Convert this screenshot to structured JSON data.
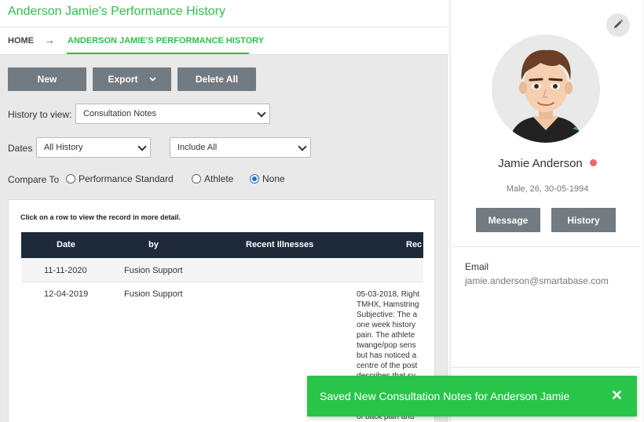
{
  "page": {
    "title": "Anderson Jamie's Performance History"
  },
  "breadcrumb": {
    "home": "HOME",
    "arrow": "→",
    "current": "ANDERSON JAMIE'S PERFORMANCE HISTORY"
  },
  "toolbar": {
    "new_label": "New",
    "export_label": "Export",
    "delete_all_label": "Delete All"
  },
  "filters": {
    "history_label": "History to view:",
    "history_value": "Consultation Notes",
    "dates_label": "Dates",
    "dates_value": "All History",
    "include_value": "Include All",
    "compare_label": "Compare To",
    "compare_options": [
      {
        "label": "Performance Standard",
        "selected": false
      },
      {
        "label": "Athlete",
        "selected": false
      },
      {
        "label": "None",
        "selected": true
      }
    ]
  },
  "table": {
    "hint": "Click on a row to view the record in more detail.",
    "columns": [
      "Date",
      "by",
      "Recent Illnesses",
      "Rec"
    ],
    "rows": [
      {
        "date": "11-11-2020",
        "by": "Fusion Support",
        "illnesses": "",
        "record": []
      },
      {
        "date": "12-04-2019",
        "by": "Fusion Support",
        "illnesses": "",
        "record": [
          "05-03-2018, Right",
          "TMHX, Hamstring",
          "Subjective: The a",
          "one week history",
          "pain. The athlete",
          "twange/pop sens",
          "but has noticed a",
          "centre of the post",
          "describes that sy",
          "",
          "",
          "",
          "of back pain and"
        ]
      }
    ]
  },
  "profile": {
    "name": "Jamie Anderson",
    "status_color": "#f06565",
    "meta": "Male, 26, 30-05-1994",
    "message_label": "Message",
    "history_label": "History",
    "email_label": "Email",
    "email_value": "jamie.anderson@smartabase.com",
    "edit_icon": "pencil-icon"
  },
  "toast": {
    "message": "Saved New Consultation Notes for Anderson Jamie",
    "close": "✕"
  },
  "colors": {
    "accent": "#2fbf4a",
    "button": "#727b82",
    "table_header": "#1e2a3a",
    "toast": "#29c44a"
  }
}
